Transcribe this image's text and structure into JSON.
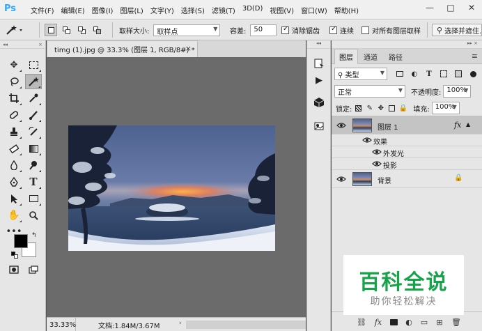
{
  "app": {
    "logo": "Ps"
  },
  "menu": [
    "文件(F)",
    "编辑(E)",
    "图像(I)",
    "图层(L)",
    "文字(Y)",
    "选择(S)",
    "滤镜(T)",
    "3D(D)",
    "视图(V)",
    "窗口(W)",
    "帮助(H)"
  ],
  "window_controls": {
    "minimize": "—",
    "maximize": "□",
    "close": "✕"
  },
  "options": {
    "sample_size_label": "取样大小:",
    "sample_size_value": "取样点",
    "tolerance_label": "容差:",
    "tolerance_value": "50",
    "antialias_label": "消除锯齿",
    "antialias_checked": true,
    "contiguous_label": "连续",
    "contiguous_checked": true,
    "sample_all_label": "对所有图层取样",
    "sample_all_checked": false,
    "select_mask_label": "选择并遮住..."
  },
  "document": {
    "tab_title": "timg (1).jpg @ 33.3% (图层 1, RGB/8#) *",
    "tab_close": "×",
    "zoom": "33.33%",
    "doc_size": "文档:1.84M/3.67M"
  },
  "layers_panel": {
    "tabs": [
      "图层",
      "通道",
      "路径"
    ],
    "filter_label": "类型",
    "blend_mode": "正常",
    "opacity_label": "不透明度:",
    "opacity_value": "100%",
    "lock_label": "锁定:",
    "fill_label": "填充:",
    "fill_value": "100%",
    "layers": [
      {
        "name": "图层 1",
        "fx": "fx",
        "effects_label": "效果",
        "effects": [
          "外发光",
          "投影"
        ]
      },
      {
        "name": "背景"
      }
    ]
  },
  "watermark": {
    "title": "百科全说",
    "subtitle": "助你轻松解决"
  },
  "colors": {
    "foreground": "#000000",
    "background": "#ffffff"
  }
}
